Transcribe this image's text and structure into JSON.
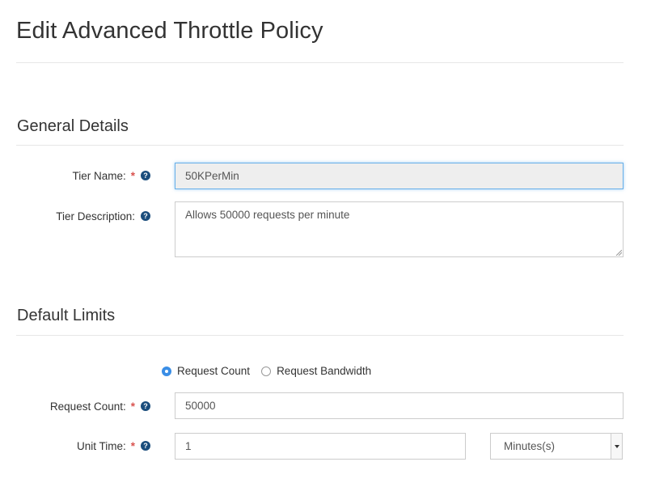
{
  "page": {
    "title": "Edit Advanced Throttle Policy"
  },
  "general": {
    "title": "General Details",
    "tier_name": {
      "label": "Tier Name:",
      "value": "50KPerMin",
      "required": "*"
    },
    "tier_description": {
      "label": "Tier Description:",
      "value": "Allows 50000 requests per minute"
    }
  },
  "limits": {
    "title": "Default Limits",
    "radio_options": [
      {
        "label": "Request Count",
        "checked": true
      },
      {
        "label": "Request Bandwidth",
        "checked": false
      }
    ],
    "request_count": {
      "label": "Request Count:",
      "value": "50000",
      "required": "*"
    },
    "unit_time": {
      "label": "Unit Time:",
      "value": "1",
      "required": "*",
      "unit_selected": "Minutes(s)"
    }
  },
  "icons": {
    "help": "question-circle-icon",
    "help_glyph": "?"
  },
  "colors": {
    "required": "#d9534f",
    "help": "#1a4d7c",
    "radio_checked": "#3a8ee6",
    "focus": "#66afe9"
  }
}
